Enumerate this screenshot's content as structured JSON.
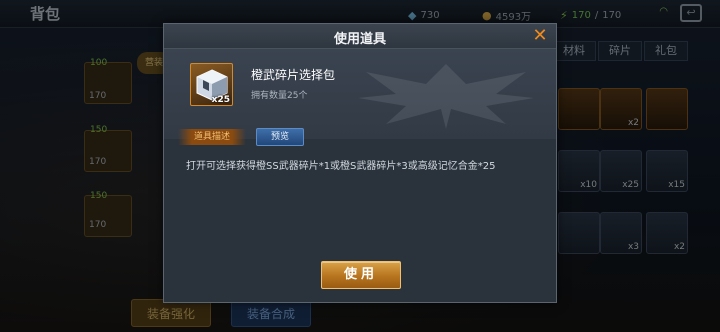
{
  "background": {
    "title": "背包",
    "resources": {
      "diamond": "730",
      "gold": "4593万",
      "energy_current": "170",
      "energy_sep": "/",
      "energy_max": "170"
    },
    "tabs": [
      "材料",
      "碎片",
      "礼包"
    ],
    "left_items": [
      {
        "level": "100",
        "num": "170"
      },
      {
        "level": "150",
        "num": "170"
      },
      {
        "level": "150",
        "num": "170"
      }
    ],
    "armored_tag": "营装",
    "right_counts": [
      "x2",
      "x10",
      "x25",
      "x15",
      "x3",
      "x2"
    ],
    "bottom_buttons": {
      "enhance": "装备强化",
      "combine": "装备合成"
    }
  },
  "dialog": {
    "title": "使用道具",
    "close_symbol": "✕",
    "item": {
      "name": "橙武碎片选择包",
      "count_badge": "x25",
      "owned": "拥有数量25个"
    },
    "desc_label": "道具描述",
    "preview_label": "预览",
    "description": "打开可选择获得橙SS武器碎片*1或橙S武器碎片*3或高级记忆合金*25",
    "use_label": "使用"
  },
  "colors": {
    "accent_orange": "#f08a1c",
    "use_button": "#c07a20",
    "preview_button": "#2f5a90",
    "panel_bg": "#2a323c"
  }
}
